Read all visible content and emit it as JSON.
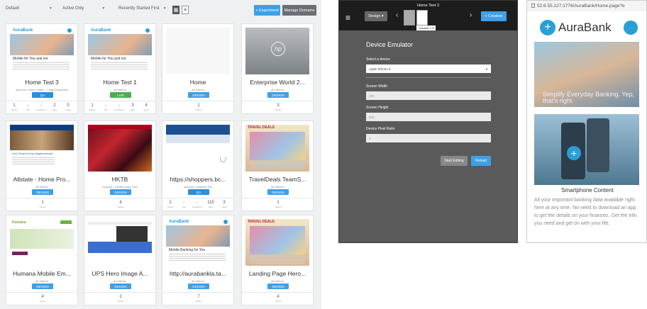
{
  "toolbar": {
    "filter1": "Default",
    "filter2": "Active Only",
    "filter3": "Recently Started First",
    "new_experiment": "+ Experiment",
    "manage_domains": "Manage Domains"
  },
  "cards": [
    {
      "title": "Home Test 3",
      "sub": "account / demo retailer · Large Enterprise",
      "badge": "QA",
      "badge_color": "#2d8fd5",
      "stats": [
        "1",
        "-",
        "-",
        "2",
        "0"
      ],
      "stat_labels": [
        "visitors",
        "CR",
        "confidence",
        "days",
        "views"
      ],
      "thumb": "aura"
    },
    {
      "title": "Home Test 1",
      "sub": "ab visitors",
      "badge": "LIVE",
      "badge_color": "#4caf50",
      "stats": [
        "1",
        "-",
        "-",
        "3",
        "4"
      ],
      "stat_labels": [
        "visitors",
        "CR",
        "confidence",
        "days",
        "views"
      ],
      "thumb": "aura"
    },
    {
      "title": "Home",
      "sub": "ab visitors",
      "badge": "DESIGN",
      "badge_color": "#3ea0e6",
      "stats": [
        "1"
      ],
      "stat_labels": [
        "visitors"
      ],
      "thumb": "blank"
    },
    {
      "title": "Enterprise World 2...",
      "sub": "ab visitors",
      "badge": "DESIGN",
      "badge_color": "#3ea0e6",
      "stats": [
        "3"
      ],
      "stat_labels": [
        "visitors"
      ],
      "thumb": "hp"
    },
    {
      "title": "Allstate - Home Pro...",
      "sub": "ab visitors",
      "badge": "DESIGN",
      "badge_color": "#3ea0e6",
      "stats": [
        "1"
      ],
      "stat_labels": [
        "visitors"
      ],
      "thumb": "allstate"
    },
    {
      "title": "HKTB",
      "sub": "account / Desain Apple Pad",
      "badge": "DESIGN",
      "badge_color": "#3ea0e6",
      "stats": [
        "4"
      ],
      "stat_labels": [
        "visitors"
      ],
      "thumb": "hktb"
    },
    {
      "title": "https://shoppers.bc...",
      "sub": "account / Installed 3ed",
      "badge": "QA",
      "badge_color": "#2d8fd5",
      "stats": [
        "2",
        "-",
        "-",
        "115",
        "3"
      ],
      "stat_labels": [
        "visitors",
        "CR",
        "confidence",
        "days",
        "views"
      ],
      "thumb": "shoppers"
    },
    {
      "title": "TravelDeals TeamS...",
      "sub": "ab visitors",
      "badge": "DESIGN",
      "badge_color": "#3ea0e6",
      "stats": [
        "1"
      ],
      "stat_labels": [
        "visitors"
      ],
      "thumb": "travel"
    },
    {
      "title": "Humana Mobile Em...",
      "sub": "ab visitors",
      "badge": "DESIGN",
      "badge_color": "#3ea0e6",
      "stats": [
        "4"
      ],
      "stat_labels": [
        "visitors"
      ],
      "thumb": "humana"
    },
    {
      "title": "UPS Hero Image A...",
      "sub": "ab visitors",
      "badge": "DESIGN",
      "badge_color": "#3ea0e6",
      "stats": [
        "2"
      ],
      "stat_labels": [
        "visitors"
      ],
      "thumb": "ups"
    },
    {
      "title": "http://aurabankla.ta...",
      "sub": "ab visitors",
      "badge": "DESIGN",
      "badge_color": "#3ea0e6",
      "stats": [
        "7"
      ],
      "stat_labels": [
        "visitors"
      ],
      "thumb": "aura2"
    },
    {
      "title": "Landing Page Hero...",
      "sub": "ab visitors",
      "badge": "DESIGN",
      "badge_color": "#3ea0e6",
      "stats": [
        "4"
      ],
      "stat_labels": [
        "visitors"
      ],
      "thumb": "travel"
    }
  ],
  "thumb_text": {
    "aura_logo": "AuraBank",
    "aura_tag": "Mobile for You and me",
    "aura2_tag": "Mobile Banking for You",
    "hp_logo": "hp",
    "allstate_logo": "Allstate",
    "allstate_tag": "Live Close to Any Neighborhood",
    "travel_logo": "TRAVEL DEALS",
    "humana_logo": "Humana"
  },
  "emulator": {
    "test_title": "Home Test 3",
    "design_label": "Design ▾",
    "creative_label": "Creative 1 ▾",
    "new_creative": "+ Creative",
    "heading": "Device Emulator",
    "device_label": "Select a device",
    "device_value": "Apple iPhone 5",
    "width_label": "Screen Width",
    "width_value": "320",
    "height_label": "Screen Height",
    "height_value": "568",
    "ratio_label": "Device Pixel Ratio",
    "ratio_value": "2",
    "start_editing": "Start Editing",
    "reload": "Reload"
  },
  "preview": {
    "url": "52.6.55.227:1776/AuraBank/Home.page?e",
    "logo": "AuraBank",
    "hero_text": "Simplify Everyday Banking. Yep, that's right.",
    "caption": "Smartphone Content",
    "body": "All your important banking data available right here at any time. No need to download an app to get the details on your finances. Get the info you need and get on with your life."
  }
}
